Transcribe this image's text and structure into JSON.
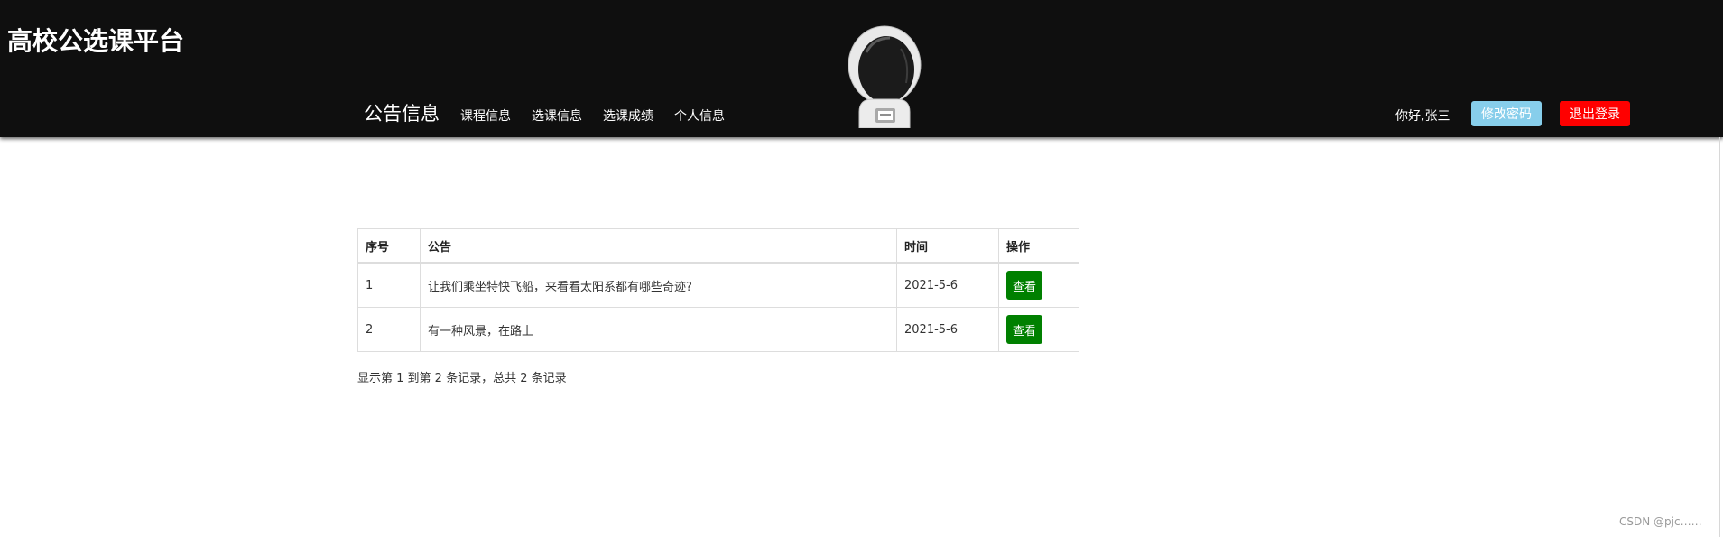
{
  "header": {
    "brand": "高校公选课平台",
    "nav": [
      {
        "label": "公告信息",
        "active": true
      },
      {
        "label": "课程信息"
      },
      {
        "label": "选课信息"
      },
      {
        "label": "选课成绩"
      },
      {
        "label": "个人信息"
      }
    ],
    "greeting": "你好,张三",
    "change_password_label": "修改密码",
    "logout_label": "退出登录"
  },
  "table": {
    "columns": [
      "序号",
      "公告",
      "时间",
      "操作"
    ],
    "rows": [
      {
        "no": "1",
        "title": "让我们乘坐特快飞船，来看看太阳系都有哪些奇迹?",
        "time": "2021-5-6",
        "action": "查看"
      },
      {
        "no": "2",
        "title": "有一种风景，在路上",
        "time": "2021-5-6",
        "action": "查看"
      }
    ]
  },
  "pagination": {
    "summary": "显示第 1 到第 2 条记录，总共 2 条记录"
  },
  "watermark": "CSDN @pjc……",
  "colors": {
    "header_bg": "#0f0f0f",
    "change_password_bg": "#87ceeb",
    "logout_bg": "#ff0000",
    "view_button_bg": "#008000"
  }
}
